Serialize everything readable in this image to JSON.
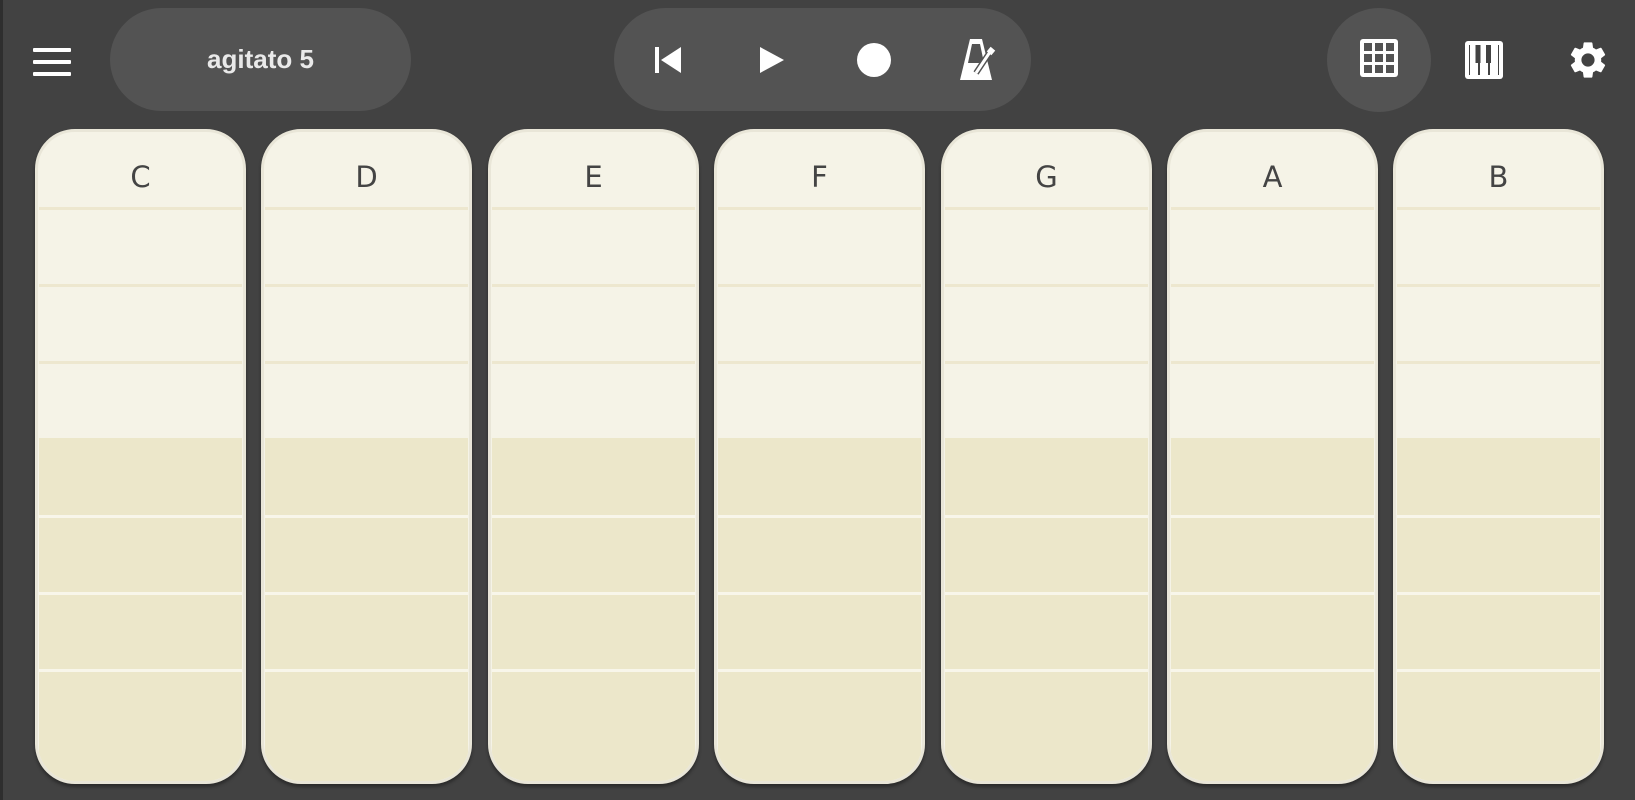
{
  "toolbar": {
    "menu_icon": "hamburger-menu-icon",
    "song_title": "agitato 5",
    "transport": {
      "rewind_icon": "skip-to-start-icon",
      "play_icon": "play-icon",
      "record_icon": "record-icon",
      "metronome_icon": "metronome-icon"
    },
    "grid_view_icon": "grid-icon",
    "keyboard_view_icon": "piano-keys-icon",
    "settings_icon": "gear-icon"
  },
  "pads": [
    {
      "label": "C"
    },
    {
      "label": "D"
    },
    {
      "label": "E"
    },
    {
      "label": "F"
    },
    {
      "label": "G"
    },
    {
      "label": "A"
    },
    {
      "label": "B"
    }
  ],
  "colors": {
    "background": "#424242",
    "pill": "#535353",
    "pad_light": "#f5f3e7",
    "pad_dark": "#ece7ca",
    "label": "#444444",
    "icon": "#ffffff"
  }
}
